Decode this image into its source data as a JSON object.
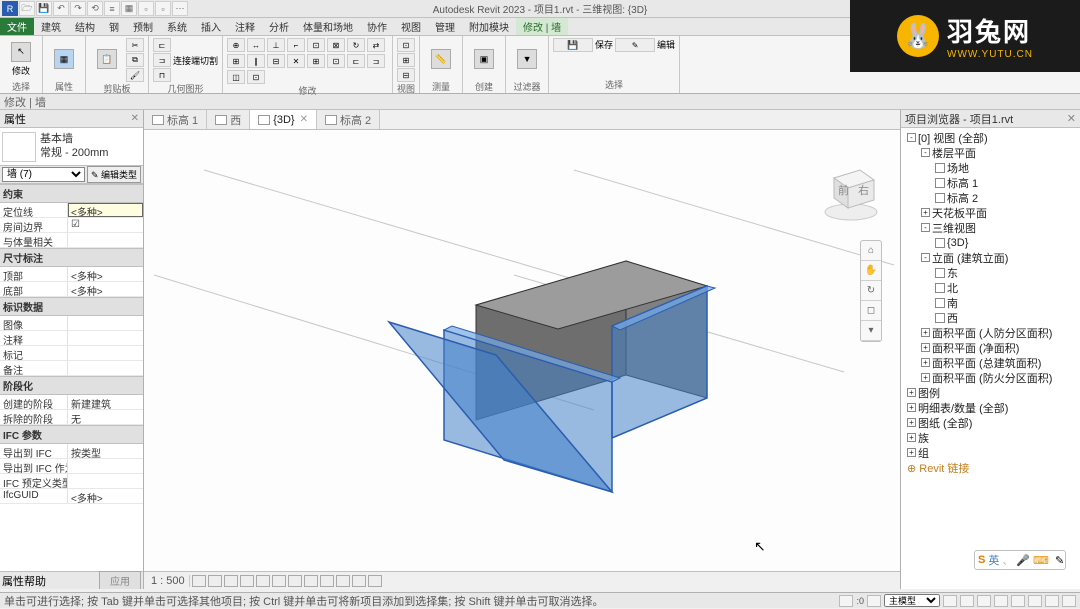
{
  "app": {
    "title": "Autodesk Revit 2023 - 项目1.rvt - 三维视图: {3D}",
    "qat_icons": [
      "R",
      "□",
      "≡",
      "↶",
      "↷",
      "⟲",
      "≡",
      "▦",
      "▫",
      "▫",
      "⋯"
    ]
  },
  "menu": {
    "tabs": [
      "文件",
      "建筑",
      "结构",
      "钢",
      "预制",
      "系统",
      "插入",
      "注释",
      "分析",
      "体量和场地",
      "协作",
      "视图",
      "管理",
      "附加模块",
      "修改 | 墙"
    ],
    "active": "修改 | 墙"
  },
  "ribbon": {
    "groups": [
      {
        "label": "选择",
        "big": [
          "修改"
        ]
      },
      {
        "label": "属性",
        "big": [
          "属性"
        ]
      },
      {
        "label": "剪贴板",
        "big": [
          "粘贴板"
        ]
      },
      {
        "label": "几何图形",
        "small_rows": 3,
        "small_cols": 3,
        "text": "连接端切割"
      },
      {
        "label": "修改",
        "small_rows": 3,
        "small_cols": 6
      },
      {
        "label": "视图",
        "small_rows": 3,
        "small_cols": 2
      },
      {
        "label": "测量",
        "big": [
          "测量"
        ]
      },
      {
        "label": "创建",
        "big": [
          "创建"
        ]
      },
      {
        "label": "过滤器",
        "big": [
          "过滤器"
        ]
      },
      {
        "label": "选择",
        "big_icon": "保存",
        "extra": "编辑"
      }
    ]
  },
  "selector_row": "修改 | 墙",
  "properties": {
    "header": "属性",
    "type_name_line1": "基本墙",
    "type_name_line2": "常规 - 200mm",
    "instance_selector": "墙 (7)",
    "edit_type_btn": "✎ 编辑类型",
    "sections": [
      {
        "head": "约束",
        "rows": [
          {
            "label": "定位线",
            "value": "<多种>",
            "hl": true
          },
          {
            "label": "房间边界",
            "value": "☑"
          },
          {
            "label": "与体量相关",
            "value": ""
          }
        ]
      },
      {
        "head": "尺寸标注",
        "rows": [
          {
            "label": "顶部",
            "value": "<多种>"
          },
          {
            "label": "底部",
            "value": "<多种>"
          }
        ]
      },
      {
        "head": "标识数据",
        "rows": [
          {
            "label": "图像",
            "value": ""
          },
          {
            "label": "注释",
            "value": ""
          },
          {
            "label": "标记",
            "value": ""
          },
          {
            "label": "备注",
            "value": ""
          }
        ]
      },
      {
        "head": "阶段化",
        "rows": [
          {
            "label": "创建的阶段",
            "value": "新建建筑"
          },
          {
            "label": "拆除的阶段",
            "value": "无"
          }
        ]
      },
      {
        "head": "IFC 参数",
        "rows": [
          {
            "label": "导出到 IFC",
            "value": "按类型"
          },
          {
            "label": "导出到 IFC 作为",
            "value": ""
          },
          {
            "label": "IFC 预定义类型",
            "value": ""
          },
          {
            "label": "IfcGUID",
            "value": "<多种>"
          }
        ]
      }
    ],
    "footer_label": "属性帮助",
    "apply_btn": "应用"
  },
  "view_tabs": [
    {
      "label": "标高 1",
      "icon": true,
      "close": false
    },
    {
      "label": "西",
      "icon": true,
      "close": false
    },
    {
      "label": "{3D}",
      "icon": true,
      "close": true,
      "active": true
    },
    {
      "label": "标高 2",
      "icon": true,
      "close": false
    }
  ],
  "viewcube_label": "前 右",
  "navbar_icons": [
    "⌂",
    "✋",
    "↻",
    "◻",
    "▾"
  ],
  "view_controls": {
    "scale": "1 : 500",
    "icons": 13
  },
  "browser": {
    "header": "项目浏览器 - 项目1.rvt",
    "tree": [
      {
        "l": 0,
        "t": "-",
        "txt": "[0] 视图 (全部)",
        "bold": false
      },
      {
        "l": 1,
        "t": "-",
        "txt": "楼层平面"
      },
      {
        "l": 2,
        "cb": true,
        "txt": "场地"
      },
      {
        "l": 2,
        "cb": true,
        "txt": "标高 1"
      },
      {
        "l": 2,
        "cb": true,
        "txt": "标高 2"
      },
      {
        "l": 1,
        "t": "+",
        "txt": "天花板平面"
      },
      {
        "l": 1,
        "t": "-",
        "txt": "三维视图"
      },
      {
        "l": 2,
        "cb": true,
        "txt": "{3D}"
      },
      {
        "l": 1,
        "t": "-",
        "txt": "立面 (建筑立面)"
      },
      {
        "l": 2,
        "cb": true,
        "txt": "东"
      },
      {
        "l": 2,
        "cb": true,
        "txt": "北"
      },
      {
        "l": 2,
        "cb": true,
        "txt": "南"
      },
      {
        "l": 2,
        "cb": true,
        "txt": "西"
      },
      {
        "l": 1,
        "t": "+",
        "txt": "面积平面 (人防分区面积)"
      },
      {
        "l": 1,
        "t": "+",
        "txt": "面积平面 (净面积)"
      },
      {
        "l": 1,
        "t": "+",
        "txt": "面积平面 (总建筑面积)"
      },
      {
        "l": 1,
        "t": "+",
        "txt": "面积平面 (防火分区面积)"
      },
      {
        "l": 0,
        "t": "+",
        "txt": "图例"
      },
      {
        "l": 0,
        "t": "+",
        "txt": "明细表/数量 (全部)"
      },
      {
        "l": 0,
        "t": "+",
        "txt": "图纸 (全部)"
      },
      {
        "l": 0,
        "t": "+",
        "txt": "族"
      },
      {
        "l": 0,
        "t": "+",
        "txt": "组"
      },
      {
        "l": 0,
        "t": "",
        "txt": "⊕ Revit 链接",
        "color": "#c08020"
      }
    ]
  },
  "watermark": {
    "cn": "羽兔网",
    "en": "WWW.YUTU.CN"
  },
  "ime": {
    "s": "S",
    "ch": "英",
    "items": [
      "、",
      "🎤",
      "⌨",
      "▦",
      "✎"
    ]
  },
  "status": {
    "left": "单击可进行选择; 按 Tab 键并单击可选择其他项目; 按 Ctrl 键并单击可将新项目添加到选择集; 按 Shift 键并单击可取消选择。",
    "model_label": "主模型",
    "right_icons": 10
  },
  "chart_data": null
}
